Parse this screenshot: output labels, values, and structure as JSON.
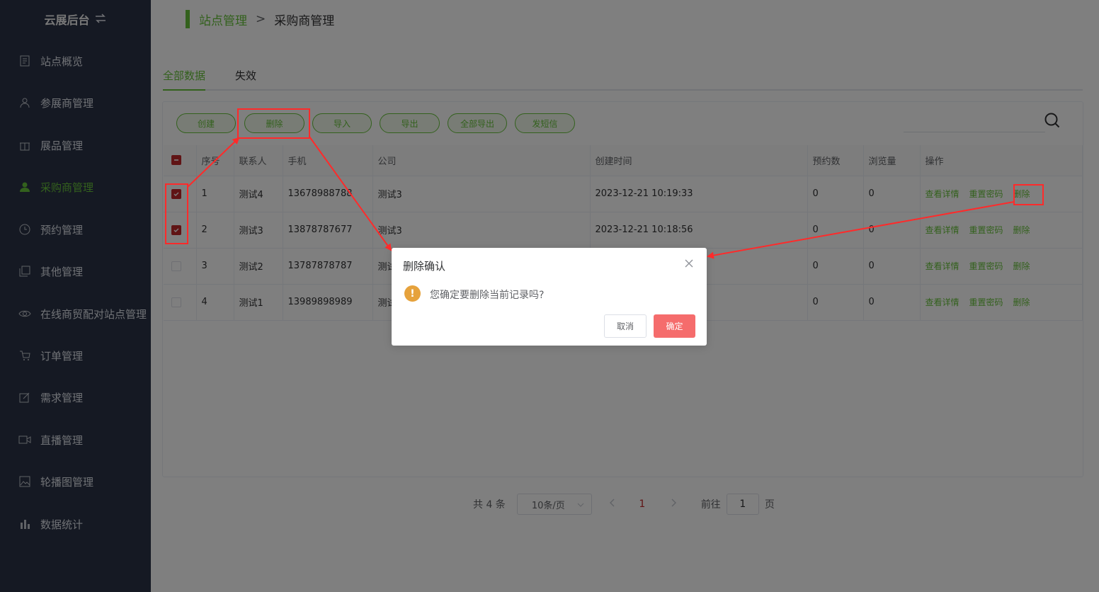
{
  "sidebar": {
    "brand": "云展后台",
    "items": [
      {
        "label": "站点概览",
        "icon": "document-icon"
      },
      {
        "label": "参展商管理",
        "icon": "user-icon"
      },
      {
        "label": "展品管理",
        "icon": "gift-icon"
      },
      {
        "label": "采购商管理",
        "icon": "user-filled-icon",
        "active": true
      },
      {
        "label": "预约管理",
        "icon": "clock-icon"
      },
      {
        "label": "其他管理",
        "icon": "copy-icon"
      },
      {
        "label": "在线商贸配对站点管理",
        "icon": "eye-icon"
      },
      {
        "label": "订单管理",
        "icon": "cart-icon"
      },
      {
        "label": "需求管理",
        "icon": "edit-icon"
      },
      {
        "label": "直播管理",
        "icon": "video-icon"
      },
      {
        "label": "轮播图管理",
        "icon": "picture-icon"
      },
      {
        "label": "数据统计",
        "icon": "bar-chart-icon"
      }
    ]
  },
  "breadcrumb": {
    "parent": "站点管理",
    "separator": ">",
    "current": "采购商管理"
  },
  "tabs": [
    {
      "label": "全部数据",
      "active": true
    },
    {
      "label": "失效",
      "active": false
    }
  ],
  "toolbar": {
    "create": "创建",
    "delete": "删除",
    "import": "导入",
    "export": "导出",
    "export_all": "全部导出",
    "send_sms": "发短信"
  },
  "table": {
    "headers": {
      "index": "序号",
      "contact": "联系人",
      "phone": "手机",
      "company": "公司",
      "created": "创建时间",
      "appointments": "预约数",
      "views": "浏览量",
      "actions": "操作"
    },
    "rows": [
      {
        "index": "1",
        "contact": "测试4",
        "phone": "13678988788",
        "company": "测试3",
        "created": "2023-12-21 10:19:33",
        "appointments": "0",
        "views": "0",
        "checked": true
      },
      {
        "index": "2",
        "contact": "测试3",
        "phone": "13878787677",
        "company": "测试3",
        "created": "2023-12-21 10:18:56",
        "appointments": "0",
        "views": "0",
        "checked": true
      },
      {
        "index": "3",
        "contact": "测试2",
        "phone": "13787878787",
        "company": "测试",
        "created": "",
        "appointments": "0",
        "views": "0",
        "checked": false
      },
      {
        "index": "4",
        "contact": "测试1",
        "phone": "13989898989",
        "company": "测试",
        "created": "",
        "appointments": "0",
        "views": "0",
        "checked": false
      }
    ],
    "actions": {
      "view": "查看详情",
      "reset": "重置密码",
      "delete": "删除"
    }
  },
  "pager": {
    "total": "共 4 条",
    "page_size": "10条/页",
    "current_page": "1",
    "goto_prefix": "前往",
    "goto_value": "1",
    "goto_suffix": "页"
  },
  "dialog": {
    "title": "删除确认",
    "message": "您确定要删除当前记录吗?",
    "cancel": "取消",
    "confirm": "确定"
  },
  "colors": {
    "accent": "#67c23a",
    "danger": "#f56c6c",
    "checkbox": "#c0282a",
    "sidebar": "#2b3346",
    "annotation": "#ff2a2a"
  }
}
